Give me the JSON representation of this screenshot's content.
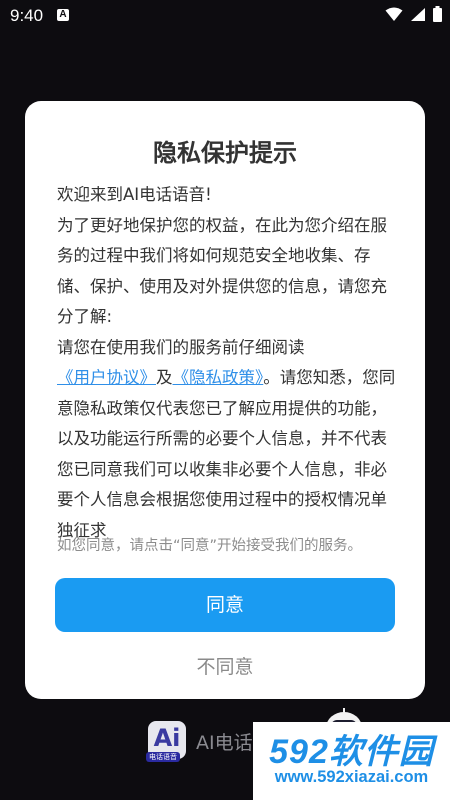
{
  "status_bar": {
    "time": "9:40",
    "icons": [
      "notification-a-icon",
      "wifi-icon",
      "signal-icon",
      "battery-icon"
    ]
  },
  "dialog": {
    "title": "隐私保护提示",
    "paragraph1": "欢迎来到AI电话语音!",
    "paragraph2": "为了更好地保护您的权益，在此为您介绍在服务的过程中我们将如何规范安全地收集、存储、保护、使用及对外提供您的信息，请您充分了解:",
    "paragraph3_prefix": "请您在使用我们的服务前仔细阅读",
    "user_agreement_link": "《用户协议》",
    "conjunction": "及",
    "privacy_policy_link": "《隐私政策》",
    "paragraph3_suffix": "。请您知悉，您同意隐私政策仅代表您已了解应用提供的功能，以及功能运行所需的必要个人信息，并不代表您已同意我们可以收集非必要个人信息，非必要个人信息会根据您使用过程中的授权情况单独征求",
    "consent_hint": "如您同意，请点击“同意”开始接受我们的服务。",
    "agree_label": "同意",
    "disagree_label": "不同意"
  },
  "background": {
    "logo_text": "Ai",
    "logo_tag": "电话语音",
    "app_name": "AI电话"
  },
  "watermark": {
    "main": "592软件园",
    "url": "www.592xiazai.com"
  },
  "colors": {
    "accent": "#1a9bf2",
    "link": "#2f8fe8",
    "background": "#0d0c10",
    "watermark": "#1e8fe6"
  }
}
